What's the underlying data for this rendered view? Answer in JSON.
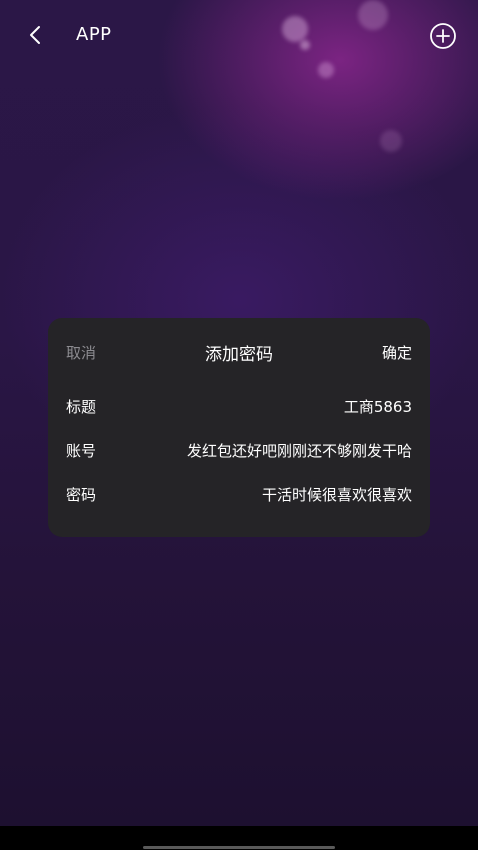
{
  "header": {
    "title": "APP",
    "back_icon": "chevron-left-icon",
    "add_icon": "plus-circle-icon"
  },
  "dialog": {
    "cancel_label": "取消",
    "title": "添加密码",
    "confirm_label": "确定",
    "fields": [
      {
        "label": "标题",
        "value": "工商5863"
      },
      {
        "label": "账号",
        "value": "发红包还好吧刚刚还不够刚发干哈"
      },
      {
        "label": "密码",
        "value": "干活时候很喜欢很喜欢"
      }
    ]
  },
  "colors": {
    "background_top": "#2b1747",
    "dialog_bg": "#252427",
    "muted_text": "#8c8b90"
  }
}
